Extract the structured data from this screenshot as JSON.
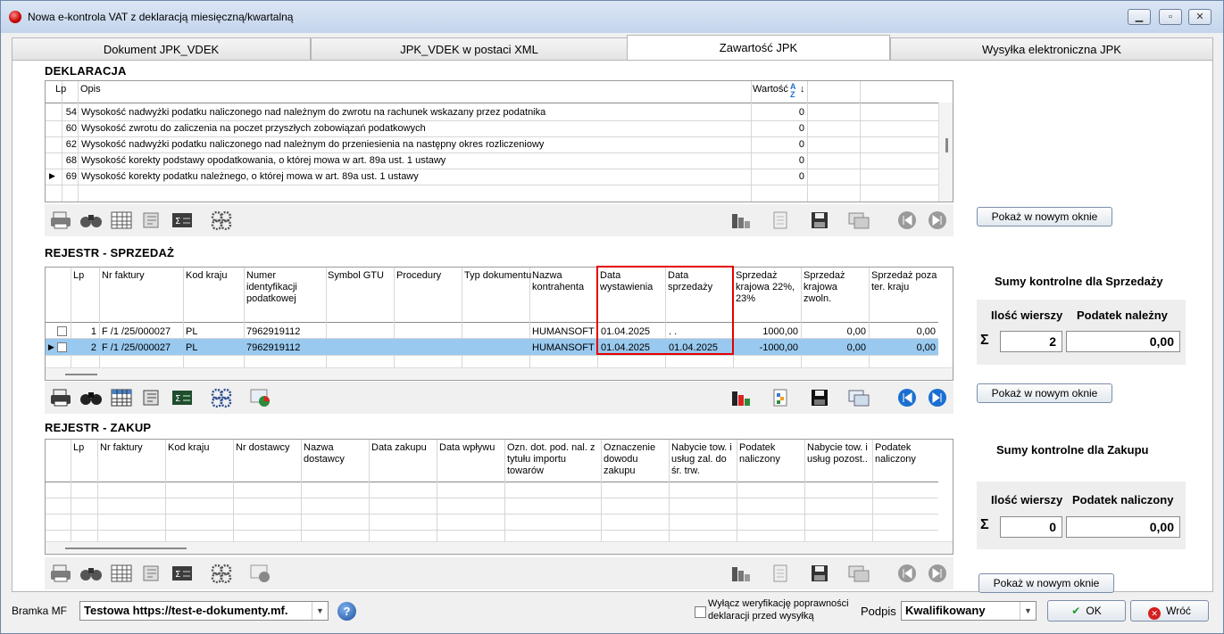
{
  "window": {
    "title": "Nowa e-kontrola VAT z deklaracją miesięczną/kwartalną"
  },
  "tabs": [
    {
      "label": "Dokument  JPK_VDEK"
    },
    {
      "label": "JPK_VDEK w postaci XML"
    },
    {
      "label": "Zawartość JPK",
      "active": true
    },
    {
      "label": "Wysyłka elektroniczna JPK"
    }
  ],
  "deklaracja": {
    "title": "DEKLARACJA",
    "columns": {
      "lp": "Lp",
      "opis": "Opis",
      "wartosc": "Wartość"
    },
    "sort_icon": "sort-az-icon",
    "rows": [
      {
        "lp": "54",
        "opis": "Wysokość nadwyżki podatku naliczonego nad należnym do zwrotu na rachunek wskazany przez podatnika",
        "wartosc": "0"
      },
      {
        "lp": "60",
        "opis": "Wysokość zwrotu do zaliczenia na poczet przyszłych zobowiązań podatkowych",
        "wartosc": "0"
      },
      {
        "lp": "62",
        "opis": "Wysokość nadwyżki podatku naliczonego nad należnym do przeniesienia na następny okres rozliczeniowy",
        "wartosc": "0"
      },
      {
        "lp": "68",
        "opis": "Wysokość korekty podstawy opodatkowania, o której mowa w art. 89a ust. 1 ustawy",
        "wartosc": "0"
      },
      {
        "lp": "69",
        "opis": "Wysokość korekty podatku należnego, o której mowa w art. 89a ust. 1 ustawy",
        "wartosc": "0"
      }
    ],
    "new_window_btn": "Pokaż w nowym oknie"
  },
  "sprzedaz": {
    "title": "REJESTR - SPRZEDAŻ",
    "columns": [
      "Lp",
      "Nr faktury",
      "Kod kraju",
      "Numer identyfikacji podatkowej",
      "Symbol GTU",
      "Procedury",
      "Typ dokumentu",
      "Nazwa kontrahenta",
      "Data wystawienia",
      "Data sprzedaży",
      "Sprzedaż krajowa 22%, 23%",
      "Sprzedaż krajowa zwoln.",
      "Sprzedaż poza ter. kraju"
    ],
    "rows": [
      {
        "lp": "1",
        "nr": "F /1  /25/000027",
        "kod": "PL",
        "nip": "7962919112",
        "gtu": "",
        "proc": "",
        "typ": "",
        "nazwa": "HUMANSOFT E",
        "data_wyst": "01.04.2025",
        "data_sprz": ". .",
        "kraj": "1000,00",
        "zwoln": "0,00",
        "poza": "0,00"
      },
      {
        "lp": "2",
        "nr": "F /1  /25/000027",
        "kod": "PL",
        "nip": "7962919112",
        "gtu": "",
        "proc": "",
        "typ": "",
        "nazwa": "HUMANSOFT E",
        "data_wyst": "01.04.2025",
        "data_sprz": "01.04.2025",
        "kraj": "-1000,00",
        "zwoln": "0,00",
        "poza": "0,00"
      }
    ],
    "new_window_btn": "Pokaż w nowym oknie",
    "sums": {
      "title": "Sumy kontrolne dla Sprzedaży",
      "col1": "Ilość wierszy",
      "col2": "Podatek należny",
      "count": "2",
      "tax": "0,00"
    }
  },
  "zakup": {
    "title": "REJESTR - ZAKUP",
    "columns": [
      "Lp",
      "Nr faktury",
      "Kod kraju",
      "Nr dostawcy",
      "Nazwa dostawcy",
      "Data zakupu",
      "Data wpływu",
      "Ozn. dot. pod. nal. z tytułu importu towarów",
      "Oznaczenie dowodu zakupu",
      "Nabycie tow. i usług zal. do śr. trw.",
      "Podatek naliczony",
      "Nabycie tow. i usług pozost..",
      "Podatek naliczony"
    ],
    "new_window_btn": "Pokaż w nowym oknie",
    "sums": {
      "title": "Sumy kontrolne dla Zakupu",
      "col1": "Ilość wierszy",
      "col2": "Podatek naliczony",
      "count": "0",
      "tax": "0,00"
    }
  },
  "footer": {
    "bramka_label": "Bramka MF",
    "bramka_value": "Testowa https://test-e-dokumenty.mf.",
    "verify_label_1": "Wyłącz weryfikację poprawności",
    "verify_label_2": "deklaracji przed wysyłką",
    "podpis_label": "Podpis",
    "podpis_value": "Kwalifikowany",
    "ok_label": "OK",
    "back_label": "Wróć"
  },
  "colors": {
    "highlight": "#e30000",
    "selected_row": "#99c9ef",
    "nav_blue": "#1b6fd1"
  }
}
